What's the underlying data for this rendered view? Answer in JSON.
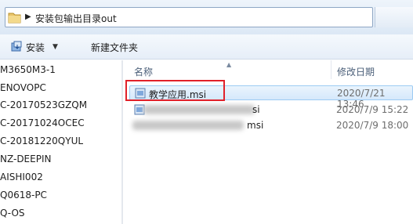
{
  "address_bar": {
    "path_segment": "安装包输出目录out"
  },
  "toolbar": {
    "install_label": "安装",
    "new_folder_label": "新建文件夹"
  },
  "nav": {
    "items": [
      "M3650M3-1",
      "ENOVOPC",
      "C-20170523GZQM",
      "C-20171024OCEC",
      "C-20181220QYUL",
      "NZ-DEEPIN",
      "AISHI002",
      "Q0618-PC",
      "Q-OS"
    ]
  },
  "columns": {
    "name": "名称",
    "modified": "修改日期"
  },
  "files": [
    {
      "name": "教学应用.msi",
      "modified": "2020/7/21 13:46",
      "selected": true
    },
    {
      "name": "si",
      "modified": "2020/7/9 15:22",
      "selected": false
    },
    {
      "name": "msi",
      "modified": "2020/7/9 18:00",
      "selected": false
    }
  ],
  "colors": {
    "selection_border": "#9ccbf3",
    "annotation_red": "#e1212a"
  }
}
